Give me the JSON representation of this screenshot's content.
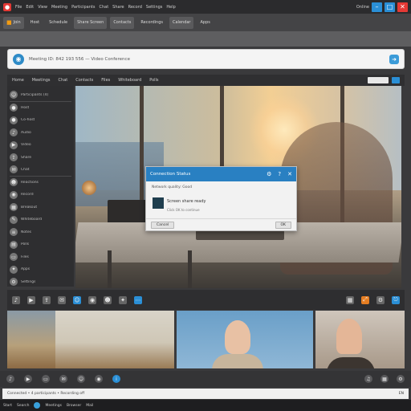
{
  "titlebar": {
    "items": [
      "File",
      "Edit",
      "View",
      "Meeting",
      "Participants",
      "Chat",
      "Share",
      "Record",
      "Settings",
      "Help"
    ],
    "right_label": "Online",
    "accent": "#e53935"
  },
  "toolbar": {
    "buttons": [
      "Join",
      "Host",
      "Schedule",
      "Share Screen",
      "Contacts",
      "Recordings",
      "Calendar",
      "Apps"
    ]
  },
  "address": {
    "text": "Meeting ID: 842 193 556 — Video Conference",
    "placeholder": "Search or enter meeting link"
  },
  "menubar": {
    "items": [
      "Home",
      "Meetings",
      "Chat",
      "Contacts",
      "Files",
      "Whiteboard",
      "Polls"
    ]
  },
  "sidebar": {
    "items": [
      {
        "label": "Participants (4)",
        "icon": "people-icon"
      },
      {
        "label": "Host",
        "icon": "user-icon"
      },
      {
        "label": "Co-host",
        "icon": "user-icon"
      },
      {
        "label": "Audio",
        "icon": "mic-icon"
      },
      {
        "label": "Video",
        "icon": "camera-icon"
      },
      {
        "label": "Share",
        "icon": "share-icon"
      },
      {
        "label": "Chat",
        "icon": "chat-icon"
      },
      {
        "label": "Reactions",
        "icon": "smile-icon"
      },
      {
        "label": "Record",
        "icon": "record-icon"
      },
      {
        "label": "Breakout",
        "icon": "grid-icon"
      },
      {
        "label": "Whiteboard",
        "icon": "pen-icon"
      },
      {
        "label": "Notes",
        "icon": "notes-icon"
      },
      {
        "label": "Polls",
        "icon": "poll-icon"
      },
      {
        "label": "Files",
        "icon": "file-icon"
      },
      {
        "label": "Apps",
        "icon": "apps-icon"
      },
      {
        "label": "Settings",
        "icon": "gear-icon"
      }
    ]
  },
  "dialog": {
    "title": "Connection Status",
    "line": "Network quality: Good",
    "label": "Screen share ready",
    "sub": "Click OK to continue",
    "ok": "OK",
    "cancel": "Cancel"
  },
  "controls": {
    "left": [
      "mute-icon",
      "video-icon",
      "share-icon",
      "chat-icon",
      "people-icon",
      "record-icon",
      "reaction-icon",
      "apps-icon",
      "more-icon"
    ],
    "right": [
      "grid-icon",
      "fullscreen-icon",
      "settings-icon",
      "leave-icon"
    ]
  },
  "statusbar": {
    "text": "Connected • 4 participants • Recording off",
    "right": "EN"
  },
  "taskbar": {
    "items": [
      "Start",
      "Search",
      "Meetings",
      "Browser",
      "Mail"
    ]
  },
  "colors": {
    "accent_blue": "#2980c2",
    "chrome_dark": "#2b2b2d"
  }
}
